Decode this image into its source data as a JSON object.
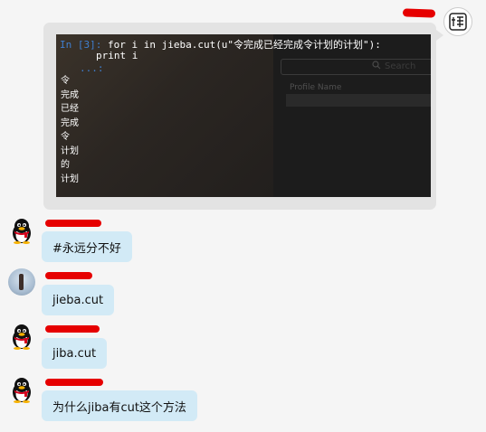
{
  "self_message": {
    "terminal": {
      "prompt": "In [3]:",
      "code_line": " for i in jieba.cut(u\"令完成已经完成令计划的计划\"):",
      "code_line_2": "print i",
      "continuation": "...:",
      "output": [
        "令",
        "完成",
        "已经",
        "完成",
        "令",
        "计划",
        "的",
        "计划"
      ],
      "ghost_search": "Search",
      "ghost_column": "Profile Name"
    }
  },
  "messages": [
    {
      "text": "#永远分不好",
      "avatar": "qq-penguin-icon"
    },
    {
      "text": "jieba.cut",
      "avatar": "photo"
    },
    {
      "text": "jiba.cut",
      "avatar": "qq-penguin-icon"
    },
    {
      "text": "为什么jiba有cut这个方法",
      "avatar": "qq-penguin-icon"
    }
  ],
  "colors": {
    "bubble_in": "#d2eaf6",
    "bubble_out": "#e3e3e3",
    "redaction": "#e60000",
    "prompt": "#3f7fd0"
  }
}
